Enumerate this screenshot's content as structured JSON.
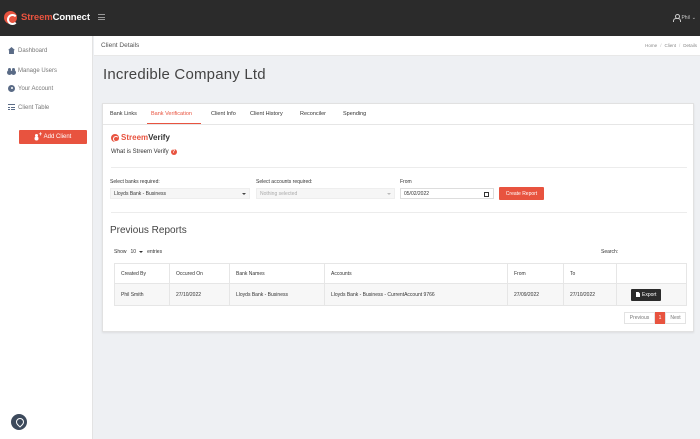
{
  "brand": {
    "name_part1": "Streem",
    "name_part2": "Connect"
  },
  "topbar": {
    "user_name": "Phil"
  },
  "sidebar": {
    "items": [
      {
        "label": "Dashboard"
      },
      {
        "label": "Manage Users"
      },
      {
        "label": "Your Account"
      },
      {
        "label": "Client Table"
      }
    ],
    "add_client_label": "Add Client"
  },
  "header": {
    "title": "Client Details",
    "breadcrumb": [
      "Home",
      "Client",
      "Details"
    ]
  },
  "page": {
    "title": "Incredible Company Ltd"
  },
  "tabs": [
    {
      "label": "Bank Links"
    },
    {
      "label": "Bank Verification"
    },
    {
      "label": "Client Info"
    },
    {
      "label": "Client History"
    },
    {
      "label": "Reconciler"
    },
    {
      "label": "Spending"
    }
  ],
  "verify": {
    "logo_part1": "Streem",
    "logo_part2": "Verify",
    "question": "What is Streem Verify",
    "help_glyph": "?"
  },
  "form": {
    "banks_label": "Select banks required:",
    "banks_value": "Lloyds Bank - Business",
    "accounts_label": "Select accounts required:",
    "accounts_placeholder": "Nothing selected",
    "from_label": "From",
    "from_value": "05/02/2022",
    "create_button": "Create Report"
  },
  "reports": {
    "title": "Previous Reports",
    "show_label": "Show",
    "entries_value": "10",
    "entries_label": "entries",
    "search_label": "Search:",
    "columns": [
      "Created By",
      "Occured On",
      "Bank Names",
      "Accounts",
      "From",
      "To",
      ""
    ],
    "rows": [
      {
        "created_by": "Phil Smith",
        "occured_on": "27/10/2022",
        "bank_names": "Lloyds Bank - Business",
        "accounts": "Lloyds Bank - Business - CurrentAccount 9766",
        "from": "27/09/2022",
        "to": "27/10/2022",
        "action": "Export"
      }
    ],
    "pagination": {
      "previous": "Previous",
      "current": "1",
      "next": "Next"
    }
  },
  "colors": {
    "accent": "#e8533f",
    "topbar": "#2b2b2b",
    "background": "#eef0f3"
  }
}
